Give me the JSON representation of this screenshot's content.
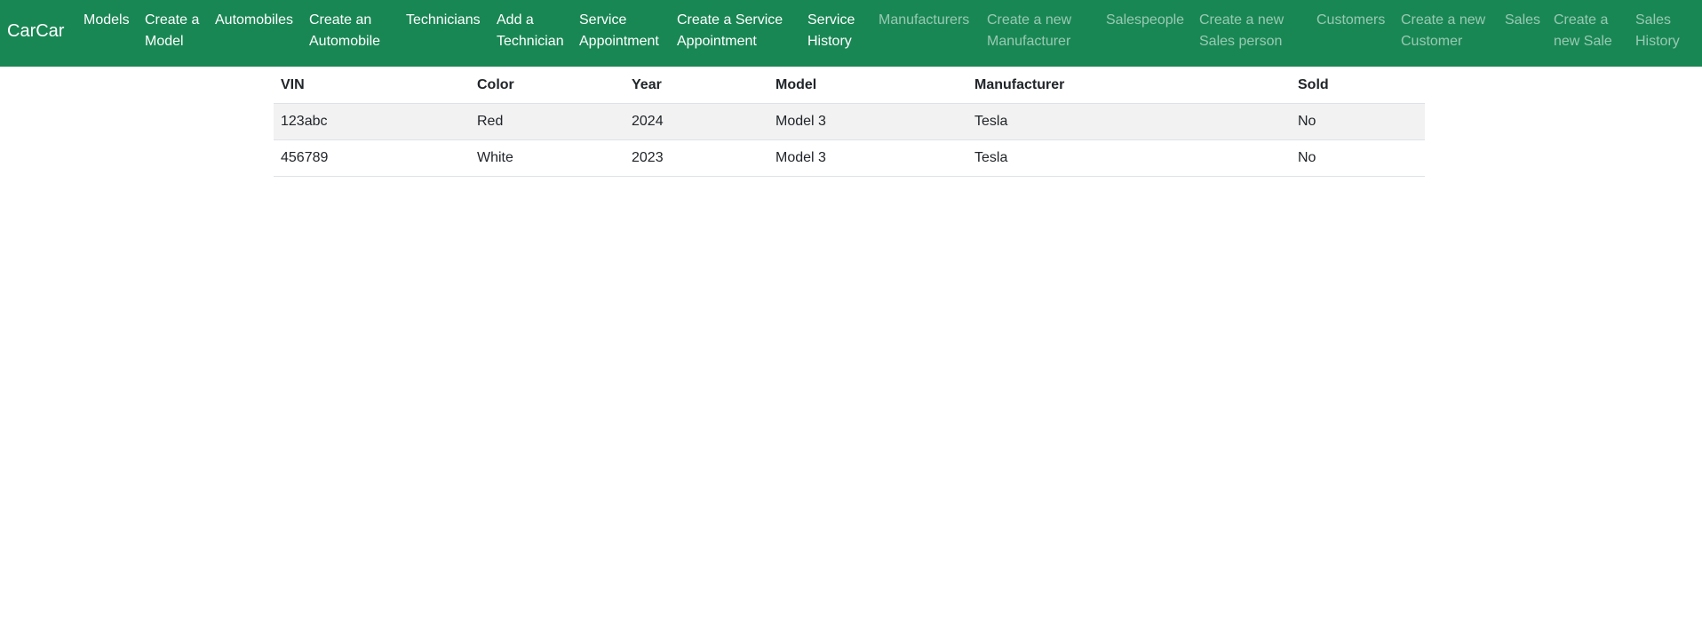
{
  "navbar": {
    "brand": "CarCar",
    "links": [
      {
        "line1": "Models",
        "line2": ""
      },
      {
        "line1": "Create a",
        "line2": "Model"
      },
      {
        "line1": "Automobiles",
        "line2": ""
      },
      {
        "line1": "Create an",
        "line2": "Automobile"
      },
      {
        "line1": "Technicians",
        "line2": ""
      },
      {
        "line1": "Add a",
        "line2": "Technician"
      },
      {
        "line1": "Service",
        "line2": "Appointment"
      },
      {
        "line1": "Create a Service",
        "line2": "Appointment"
      },
      {
        "line1": "Service",
        "line2": "History"
      },
      {
        "line1": "Manufacturers",
        "line2": ""
      },
      {
        "line1": "Create a new",
        "line2": "Manufacturer"
      },
      {
        "line1": "Salespeople",
        "line2": ""
      },
      {
        "line1": "Create a new",
        "line2": "Sales person"
      },
      {
        "line1": "Customers",
        "line2": ""
      },
      {
        "line1": "Create a new",
        "line2": "Customer"
      },
      {
        "line1": "Sales",
        "line2": ""
      },
      {
        "line1": "Create a",
        "line2": "new Sale"
      },
      {
        "line1": "Sales",
        "line2": "History"
      }
    ]
  },
  "table": {
    "headers": [
      "VIN",
      "Color",
      "Year",
      "Model",
      "Manufacturer",
      "Sold"
    ],
    "rows": [
      [
        "123abc",
        "Red",
        "2024",
        "Model 3",
        "Tesla",
        "No"
      ],
      [
        "456789",
        "White",
        "2023",
        "Model 3",
        "Tesla",
        "No"
      ]
    ]
  }
}
